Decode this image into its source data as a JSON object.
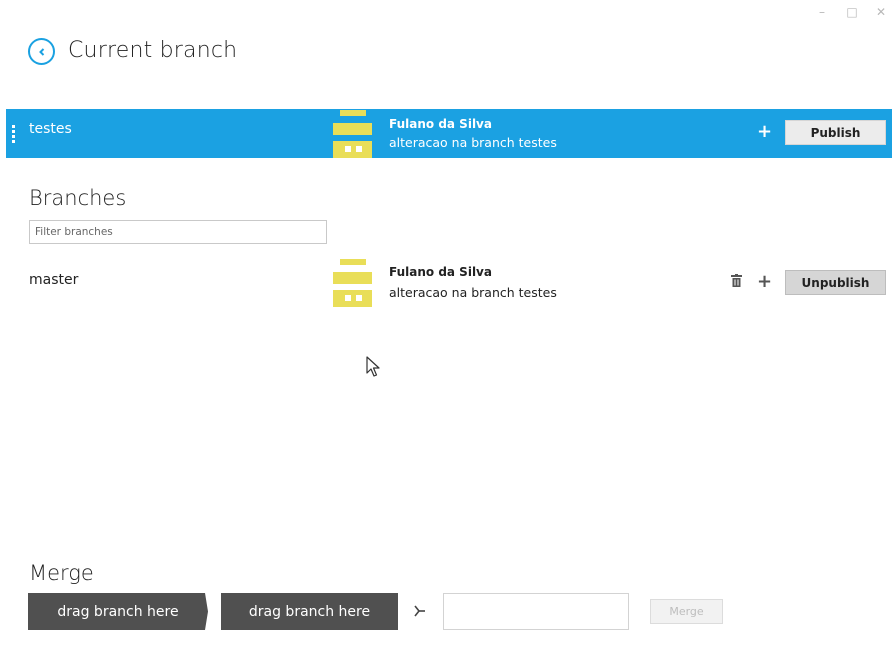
{
  "window": {
    "minimize_glyph": "–",
    "maximize_glyph": "□",
    "close_glyph": "✕"
  },
  "header": {
    "title": "Current branch",
    "back_icon": "chevron-left-icon"
  },
  "current_branch": {
    "name": "testes",
    "author": "Fulano da Silva",
    "message": "alteracao na branch testes",
    "add_glyph": "+",
    "publish_label": "Publish"
  },
  "branches": {
    "title": "Branches",
    "filter_placeholder": "Filter branches",
    "items": [
      {
        "name": "master",
        "author": "Fulano da Silva",
        "message": "alteracao na branch testes",
        "add_glyph": "+",
        "unpublish_label": "Unpublish"
      }
    ]
  },
  "merge": {
    "title": "Merge",
    "source_placeholder": "drag branch here",
    "target_placeholder": "drag branch here",
    "button_label": "Merge"
  },
  "colors": {
    "accent": "#1ba1e2",
    "avatar": "#e9de58",
    "drop_zone": "#505050"
  }
}
